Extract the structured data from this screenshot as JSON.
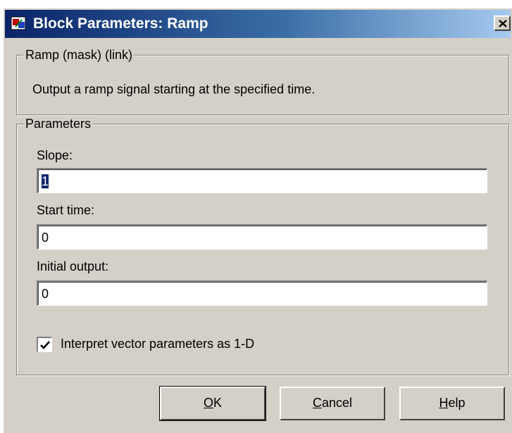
{
  "window": {
    "title": "Block Parameters: Ramp",
    "close_symbol": "×",
    "icon": "simulink-block-icon"
  },
  "description_group": {
    "legend": "Ramp (mask) (link)",
    "text": "Output a ramp signal starting at the specified time."
  },
  "parameters_group": {
    "legend": "Parameters",
    "fields": [
      {
        "label": "Slope:",
        "value": "1",
        "selected": true
      },
      {
        "label": "Start time:",
        "value": "0",
        "selected": false
      },
      {
        "label": "Initial output:",
        "value": "0",
        "selected": false
      }
    ],
    "checkbox": {
      "label": "Interpret vector parameters as 1-D",
      "checked": true
    }
  },
  "buttons": {
    "ok": {
      "mnemonic": "O",
      "rest": "K"
    },
    "cancel": {
      "mnemonic": "C",
      "rest": "ancel"
    },
    "help": {
      "mnemonic": "H",
      "rest": "elp"
    }
  },
  "colors": {
    "dialog_bg": "#d4d0c8",
    "titlebar_start": "#0a246a",
    "titlebar_end": "#a6caf0",
    "selection": "#0a246a"
  }
}
